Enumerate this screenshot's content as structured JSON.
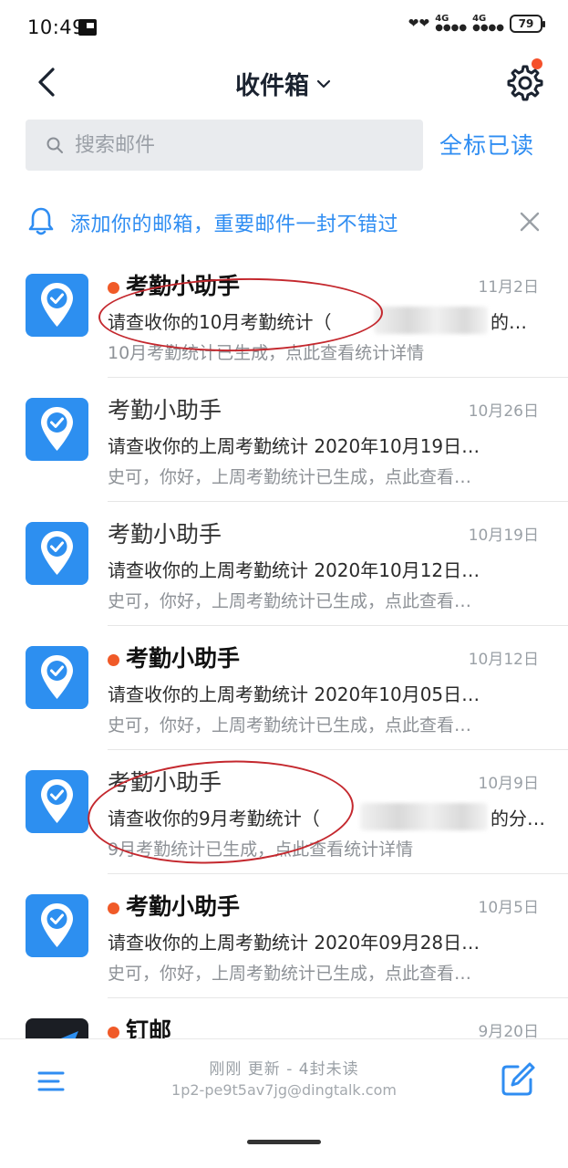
{
  "status_bar": {
    "time": "10:49",
    "net1": "4G",
    "net2": "4G",
    "battery": "79"
  },
  "header": {
    "title": "收件箱"
  },
  "search": {
    "placeholder": "搜索邮件",
    "mark_all_read": "全标已读"
  },
  "notice": {
    "text": "添加你的邮箱，重要邮件一封不错过"
  },
  "mails": [
    {
      "sender": "考勤小助手",
      "unread": true,
      "date": "11月2日",
      "subject": "请查收你的10月考勤统计（",
      "subject_tail": "的…",
      "preview": "10月考勤统计已生成，点此查看统计详情"
    },
    {
      "sender": "考勤小助手",
      "unread": false,
      "date": "10月26日",
      "subject": "请查收你的上周考勤统计  2020年10月19日…",
      "preview": "史可，你好，上周考勤统计已生成，点此查看…"
    },
    {
      "sender": "考勤小助手",
      "unread": false,
      "date": "10月19日",
      "subject": "请查收你的上周考勤统计  2020年10月12日…",
      "preview": "史可，你好，上周考勤统计已生成，点此查看…"
    },
    {
      "sender": "考勤小助手",
      "unread": true,
      "date": "10月12日",
      "subject": "请查收你的上周考勤统计  2020年10月05日…",
      "preview": "史可，你好，上周考勤统计已生成，点此查看…"
    },
    {
      "sender": "考勤小助手",
      "unread": false,
      "date": "10月9日",
      "subject": "请查收你的9月考勤统计（",
      "subject_tail": "的分…",
      "preview": "9月考勤统计已生成，点此查看统计详情"
    },
    {
      "sender": "考勤小助手",
      "unread": true,
      "date": "10月5日",
      "subject": "请查收你的上周考勤统计  2020年09月28日…",
      "preview": "史可，你好，上周考勤统计已生成，点此查看…"
    },
    {
      "sender": "钉邮",
      "unread": true,
      "date": "9月20日",
      "subject": "",
      "preview": ""
    }
  ],
  "bottom": {
    "status": "刚刚 更新 - 4封未读",
    "account": "1p2-pe9t5av7jg@dingtalk.com"
  },
  "colors": {
    "accent": "#2f8df2",
    "unread_dot": "#f05a28",
    "annotation": "#c4282e"
  }
}
